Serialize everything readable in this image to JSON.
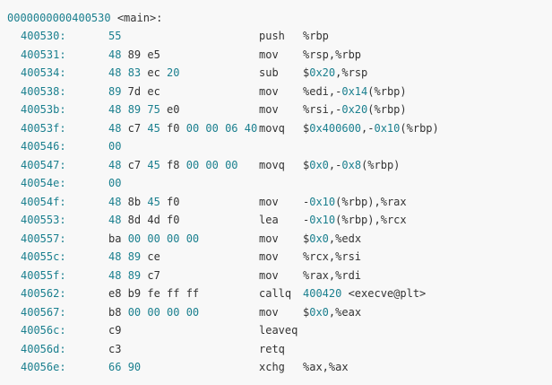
{
  "listing": {
    "header": {
      "address": "0000000000400530",
      "symbol": " <main>:"
    },
    "rows": [
      {
        "addr": "400530:",
        "bytes": [
          [
            "55",
            "num"
          ]
        ],
        "mnemonic": "push",
        "operands": [
          [
            "%rbp",
            "plain"
          ]
        ]
      },
      {
        "addr": "400531:",
        "bytes": [
          [
            "48",
            "num"
          ],
          [
            " 89 e5",
            "plain"
          ]
        ],
        "mnemonic": "mov",
        "operands": [
          [
            "%rsp,%rbp",
            "plain"
          ]
        ]
      },
      {
        "addr": "400534:",
        "bytes": [
          [
            "48",
            "num"
          ],
          [
            " ",
            "plain"
          ],
          [
            "83",
            "num"
          ],
          [
            " ec ",
            "plain"
          ],
          [
            "20",
            "num"
          ]
        ],
        "mnemonic": "sub",
        "operands": [
          [
            "$",
            "plain"
          ],
          [
            "0x20",
            "num"
          ],
          [
            ",%rsp",
            "plain"
          ]
        ]
      },
      {
        "addr": "400538:",
        "bytes": [
          [
            "89",
            "num"
          ],
          [
            " 7d ec",
            "plain"
          ]
        ],
        "mnemonic": "mov",
        "operands": [
          [
            "%edi,-",
            "plain"
          ],
          [
            "0x14",
            "num"
          ],
          [
            "(%rbp)",
            "plain"
          ]
        ]
      },
      {
        "addr": "40053b:",
        "bytes": [
          [
            "48",
            "num"
          ],
          [
            " ",
            "plain"
          ],
          [
            "89",
            "num"
          ],
          [
            " ",
            "plain"
          ],
          [
            "75",
            "num"
          ],
          [
            " e0",
            "plain"
          ]
        ],
        "mnemonic": "mov",
        "operands": [
          [
            "%rsi,-",
            "plain"
          ],
          [
            "0x20",
            "num"
          ],
          [
            "(%rbp)",
            "plain"
          ]
        ]
      },
      {
        "addr": "40053f:",
        "bytes": [
          [
            "48",
            "num"
          ],
          [
            " c7 ",
            "plain"
          ],
          [
            "45",
            "num"
          ],
          [
            " f0 ",
            "plain"
          ],
          [
            "00 00 06 40",
            "num"
          ]
        ],
        "mnemonic": "movq",
        "operands": [
          [
            "$",
            "plain"
          ],
          [
            "0x400600",
            "num"
          ],
          [
            ",-",
            "plain"
          ],
          [
            "0x10",
            "num"
          ],
          [
            "(%rbp)",
            "plain"
          ]
        ]
      },
      {
        "addr": "400546:",
        "bytes": [
          [
            "00",
            "num"
          ]
        ],
        "mnemonic": "",
        "operands": []
      },
      {
        "addr": "400547:",
        "bytes": [
          [
            "48",
            "num"
          ],
          [
            " c7 ",
            "plain"
          ],
          [
            "45",
            "num"
          ],
          [
            " f8 ",
            "plain"
          ],
          [
            "00 00 00",
            "num"
          ]
        ],
        "mnemonic": "movq",
        "operands": [
          [
            "$",
            "plain"
          ],
          [
            "0x0",
            "num"
          ],
          [
            ",-",
            "plain"
          ],
          [
            "0x8",
            "num"
          ],
          [
            "(%rbp)",
            "plain"
          ]
        ]
      },
      {
        "addr": "40054e:",
        "bytes": [
          [
            "00",
            "num"
          ]
        ],
        "mnemonic": "",
        "operands": []
      },
      {
        "addr": "40054f:",
        "bytes": [
          [
            "48",
            "num"
          ],
          [
            " 8b ",
            "plain"
          ],
          [
            "45",
            "num"
          ],
          [
            " f0",
            "plain"
          ]
        ],
        "mnemonic": "mov",
        "operands": [
          [
            "-",
            "plain"
          ],
          [
            "0x10",
            "num"
          ],
          [
            "(%rbp),%rax",
            "plain"
          ]
        ]
      },
      {
        "addr": "400553:",
        "bytes": [
          [
            "48",
            "num"
          ],
          [
            " 8d 4d f0",
            "plain"
          ]
        ],
        "mnemonic": "lea",
        "operands": [
          [
            "-",
            "plain"
          ],
          [
            "0x10",
            "num"
          ],
          [
            "(%rbp),%rcx",
            "plain"
          ]
        ]
      },
      {
        "addr": "400557:",
        "bytes": [
          [
            "ba ",
            "plain"
          ],
          [
            "00 00 00 00",
            "num"
          ]
        ],
        "mnemonic": "mov",
        "operands": [
          [
            "$",
            "plain"
          ],
          [
            "0x0",
            "num"
          ],
          [
            ",%edx",
            "plain"
          ]
        ]
      },
      {
        "addr": "40055c:",
        "bytes": [
          [
            "48",
            "num"
          ],
          [
            " ",
            "plain"
          ],
          [
            "89",
            "num"
          ],
          [
            " ce",
            "plain"
          ]
        ],
        "mnemonic": "mov",
        "operands": [
          [
            "%rcx,%rsi",
            "plain"
          ]
        ]
      },
      {
        "addr": "40055f:",
        "bytes": [
          [
            "48",
            "num"
          ],
          [
            " ",
            "plain"
          ],
          [
            "89",
            "num"
          ],
          [
            " c7",
            "plain"
          ]
        ],
        "mnemonic": "mov",
        "operands": [
          [
            "%rax,%rdi",
            "plain"
          ]
        ]
      },
      {
        "addr": "400562:",
        "bytes": [
          [
            "e8 b9 fe ff ff",
            "plain"
          ]
        ],
        "mnemonic": "callq",
        "operands": [
          [
            "400420",
            "num"
          ],
          [
            " <execve@plt>",
            "plain"
          ]
        ]
      },
      {
        "addr": "400567:",
        "bytes": [
          [
            "b8 ",
            "plain"
          ],
          [
            "00 00 00 00",
            "num"
          ]
        ],
        "mnemonic": "mov",
        "operands": [
          [
            "$",
            "plain"
          ],
          [
            "0x0",
            "num"
          ],
          [
            ",%eax",
            "plain"
          ]
        ]
      },
      {
        "addr": "40056c:",
        "bytes": [
          [
            "c9",
            "plain"
          ]
        ],
        "mnemonic": "leaveq",
        "operands": []
      },
      {
        "addr": "40056d:",
        "bytes": [
          [
            "c3",
            "plain"
          ]
        ],
        "mnemonic": "retq",
        "operands": []
      },
      {
        "addr": "40056e:",
        "bytes": [
          [
            "66",
            "num"
          ],
          [
            " ",
            "plain"
          ],
          [
            "90",
            "num"
          ]
        ],
        "mnemonic": "xchg",
        "operands": [
          [
            "%ax,%ax",
            "plain"
          ]
        ]
      }
    ]
  },
  "colors": {
    "background": "#f8f8f8",
    "text": "#333333",
    "number": "#1a7f8e"
  }
}
